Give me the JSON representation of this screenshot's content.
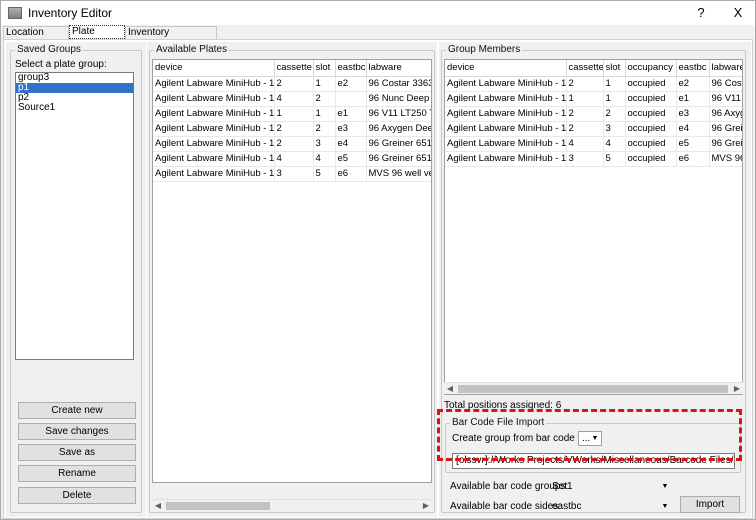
{
  "window": {
    "title": "Inventory Editor",
    "help_label": "?",
    "close_label": "X"
  },
  "tabs": [
    {
      "label": "Location Groups",
      "active": false
    },
    {
      "label": "Plate Groups",
      "active": true
    },
    {
      "label": "Inventory Management",
      "active": false
    }
  ],
  "saved_groups": {
    "title": "Saved Groups",
    "prompt": "Select a plate group:",
    "items": [
      {
        "label": "group3",
        "selected": false
      },
      {
        "label": "p1",
        "selected": true
      },
      {
        "label": "p2",
        "selected": false
      },
      {
        "label": "Source1",
        "selected": false
      }
    ],
    "buttons": {
      "create_new": "Create new",
      "save_changes": "Save changes",
      "save_as": "Save as",
      "rename": "Rename",
      "delete": "Delete"
    }
  },
  "available_plates": {
    "title": "Available Plates",
    "columns": [
      "device",
      "cassette",
      "slot",
      "eastbc",
      "labware"
    ],
    "rows": [
      [
        "Agilent Labware MiniHub - 1",
        "2",
        "1",
        "e2",
        "96 Costar 3363,"
      ],
      [
        "Agilent Labware MiniHub - 1",
        "4",
        "2",
        "",
        "96 Nunc Deep W"
      ],
      [
        "Agilent Labware MiniHub - 1",
        "1",
        "1",
        "e1",
        "96 V11 LT250 Ti"
      ],
      [
        "Agilent Labware MiniHub - 1",
        "2",
        "2",
        "e3",
        "96 Axygen Deep"
      ],
      [
        "Agilent Labware MiniHub - 1",
        "2",
        "3",
        "e4",
        "96 Greiner 6512"
      ],
      [
        "Agilent Labware MiniHub - 1",
        "4",
        "4",
        "e5",
        "96 Greiner 6512"
      ],
      [
        "Agilent Labware MiniHub - 1",
        "3",
        "5",
        "e6",
        "MVS 96 well ver"
      ]
    ],
    "scroll_left": "◀",
    "scroll_right": "▶"
  },
  "group_members": {
    "title": "Group Members",
    "columns": [
      "device",
      "cassette",
      "slot",
      "occupancy",
      "eastbc",
      "labware"
    ],
    "rows": [
      [
        "Agilent Labware MiniHub - 1",
        "2",
        "1",
        "occupied",
        "e2",
        "96 Costa"
      ],
      [
        "Agilent Labware MiniHub - 1",
        "1",
        "1",
        "occupied",
        "e1",
        "96 V11 L"
      ],
      [
        "Agilent Labware MiniHub - 1",
        "2",
        "2",
        "occupied",
        "e3",
        "96 Axyge"
      ],
      [
        "Agilent Labware MiniHub - 1",
        "2",
        "3",
        "occupied",
        "e4",
        "96 Grein"
      ],
      [
        "Agilent Labware MiniHub - 1",
        "4",
        "4",
        "occupied",
        "e5",
        "96 Grein"
      ],
      [
        "Agilent Labware MiniHub - 1",
        "3",
        "5",
        "occupied",
        "e6",
        "MVS 96"
      ]
    ],
    "total_positions": "Total positions assigned: 6",
    "scroll_left": "◀",
    "scroll_right": "▶"
  },
  "barcode_import": {
    "title": "Bar Code File Import",
    "create_label": "Create group from bar code file:",
    "browse_label": "...",
    "file_path": "[olssvr]://Works Projects/VWorks/Miscellaneous/Barcode Files/Barcode.Input",
    "groups_label": "Available bar code groups:",
    "groups_value": "Set1",
    "sides_label": "Available bar code sides:",
    "sides_value": "eastbc",
    "import_label": "Import"
  },
  "colors": {
    "selection": "#3271c9",
    "highlight": "#d7141e"
  }
}
